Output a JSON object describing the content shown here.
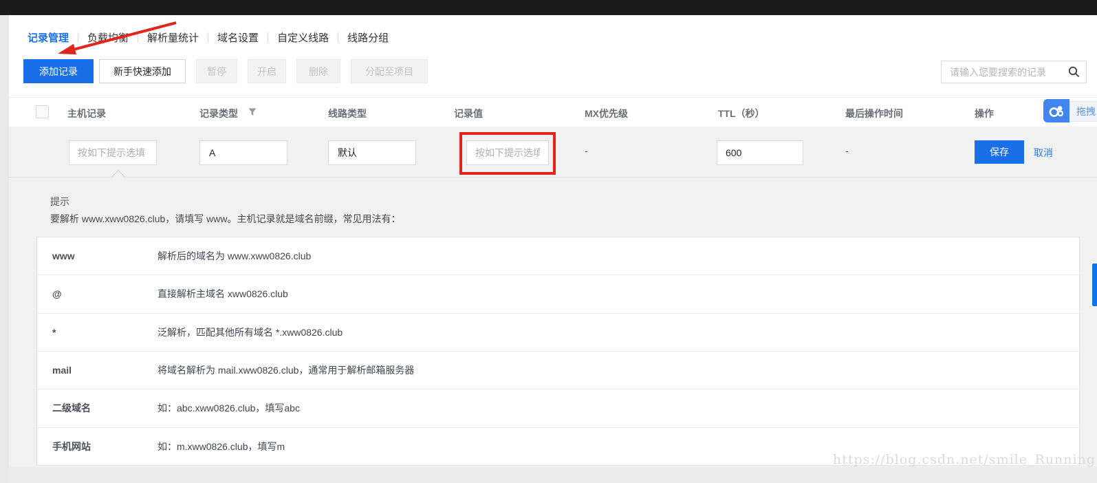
{
  "tabs": [
    {
      "label": "记录管理",
      "active": true
    },
    {
      "label": "负载均衡",
      "active": false
    },
    {
      "label": "解析量统计",
      "active": false
    },
    {
      "label": "域名设置",
      "active": false
    },
    {
      "label": "自定义线路",
      "active": false
    },
    {
      "label": "线路分组",
      "active": false
    }
  ],
  "toolbar": {
    "add_record": "添加记录",
    "quick_add": "新手快速添加",
    "pause": "暂停",
    "enable": "开启",
    "delete": "删除",
    "assign_to_project": "分配至项目",
    "search_placeholder": "请输入您要搜索的记录"
  },
  "table": {
    "headers": [
      "主机记录",
      "记录类型",
      "线路类型",
      "记录值",
      "MX优先级",
      "TTL（秒）",
      "最后操作时间",
      "操作"
    ]
  },
  "edit_row": {
    "host_placeholder": "按如下提示选填",
    "record_type": "A",
    "line_type": "默认",
    "value_placeholder": "按如下提示选填",
    "mx_priority": "-",
    "ttl": "600",
    "last_operated": "-",
    "save": "保存",
    "cancel": "取消"
  },
  "tip": {
    "title": "提示",
    "description": "要解析 www.xww0826.club，请填写 www。主机记录就是域名前缀，常见用法有：",
    "rows": [
      {
        "term": "www",
        "desc": "解析后的域名为 www.xww0826.club"
      },
      {
        "term": "@",
        "desc": "直接解析主域名 xww0826.club"
      },
      {
        "term": "*",
        "desc": "泛解析，匹配其他所有域名 *.xww0826.club"
      },
      {
        "term": "mail",
        "desc": "将域名解析为 mail.xww0826.club，通常用于解析邮箱服务器"
      },
      {
        "term": "二级域名",
        "desc": "如：abc.xww0826.club，填写abc"
      },
      {
        "term": "手机网站",
        "desc": "如：m.xww0826.club，填写m"
      }
    ]
  },
  "drag_widget": {
    "label": "拖拽"
  },
  "watermark": "https://blog.csdn.net/smile_Running",
  "icons": {
    "search": "magnifier",
    "filter": "funnel",
    "drag_widget": "three-circles-cloud"
  },
  "colors": {
    "primary_blue": "#1a6fe8",
    "annotation_red": "#e1251b",
    "widget_blue": "#4285ef",
    "side_handle_blue": "#0f74e8",
    "topbar": "#1b1b1b",
    "panel_gray": "#f1f1f2"
  }
}
